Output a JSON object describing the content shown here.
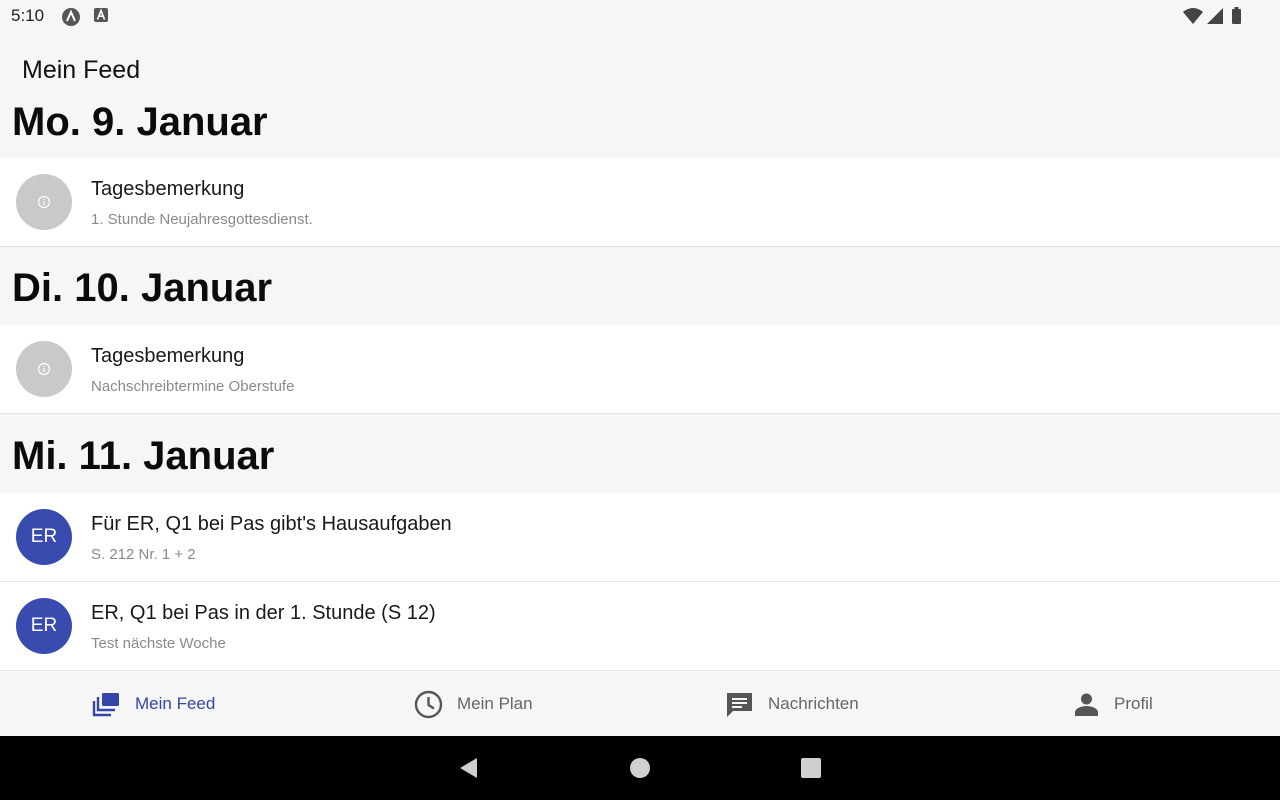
{
  "status_bar": {
    "time": "5:10"
  },
  "app_bar": {
    "title": "Mein Feed"
  },
  "feed": {
    "days": [
      {
        "header": "Mo. 9. Januar",
        "items": [
          {
            "avatar": "info-icon",
            "title": "Tagesbemerkung",
            "subtitle": "1. Stunde Neujahresgottesdienst."
          }
        ]
      },
      {
        "header": "Di. 10. Januar",
        "items": [
          {
            "avatar": "info-icon",
            "title": "Tagesbemerkung",
            "subtitle": "Nachschreibtermine Oberstufe"
          }
        ]
      },
      {
        "header": "Mi. 11. Januar",
        "items": [
          {
            "avatar_text": "ER",
            "title": "Für ER, Q1 bei Pas gibt's Hausaufgaben",
            "subtitle": "S. 212 Nr. 1 + 2"
          },
          {
            "avatar_text": "ER",
            "title": "ER, Q1 bei Pas in der 1. Stunde (S 12)",
            "subtitle": "Test nächste Woche"
          }
        ]
      }
    ]
  },
  "bottom_nav": {
    "items": [
      {
        "label": "Mein Feed",
        "icon": "feed-icon",
        "active": true
      },
      {
        "label": "Mein Plan",
        "icon": "clock-icon",
        "active": false
      },
      {
        "label": "Nachrichten",
        "icon": "message-icon",
        "active": false
      },
      {
        "label": "Profil",
        "icon": "person-icon",
        "active": false
      }
    ]
  },
  "colors": {
    "accent": "#3546a8",
    "avatar_er": "#3a4bb0",
    "avatar_info": "#c9c9c9",
    "background": "#f6f6f6",
    "card": "#ffffff"
  }
}
